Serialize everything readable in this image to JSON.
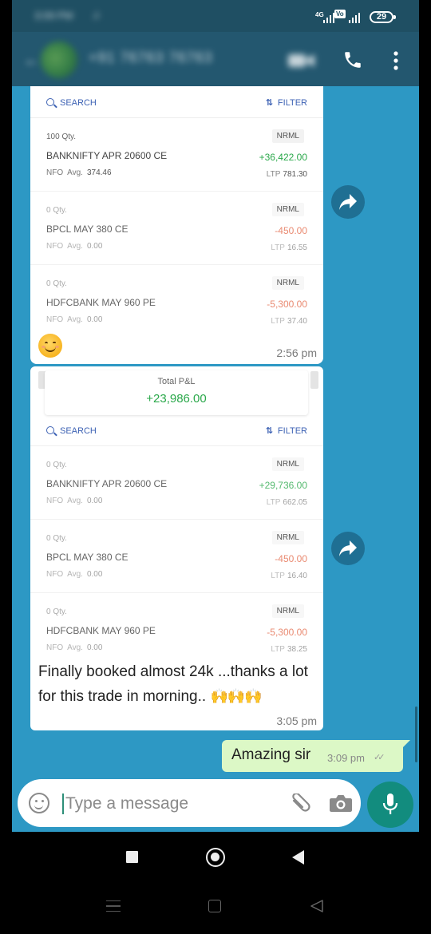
{
  "status_bar": {
    "time": "3:09 PM",
    "battery": "29"
  },
  "header": {
    "contact": "+91 76763 76763"
  },
  "positions_card_1": {
    "search_label": "SEARCH",
    "filter_label": "FILTER",
    "positions": [
      {
        "qty": "100 Qty.",
        "symbol": "BANKNIFTY APR 20600 CE",
        "exchange": "NFO",
        "avg_label": "Avg.",
        "avg": "374.46",
        "product": "NRML",
        "pnl": "+36,422.00",
        "ltp_label": "LTP",
        "ltp": "781.30"
      },
      {
        "qty": "0 Qty.",
        "symbol": "BPCL MAY 380 CE",
        "exchange": "NFO",
        "avg_label": "Avg.",
        "avg": "0.00",
        "product": "NRML",
        "pnl": "-450.00",
        "ltp_label": "LTP",
        "ltp": "16.55"
      },
      {
        "qty": "0 Qty.",
        "symbol": "HDFCBANK MAY 960 PE",
        "exchange": "NFO",
        "avg_label": "Avg.",
        "avg": "0.00",
        "product": "NRML",
        "pnl": "-5,300.00",
        "ltp_label": "LTP",
        "ltp": "37.40"
      }
    ],
    "time": "2:56 pm"
  },
  "positions_card_2": {
    "total_label": "Total P&L",
    "total_value": "+23,986.00",
    "search_label": "SEARCH",
    "filter_label": "FILTER",
    "positions": [
      {
        "qty": "0 Qty.",
        "symbol": "BANKNIFTY APR 20600 CE",
        "exchange": "NFO",
        "avg_label": "Avg.",
        "avg": "0.00",
        "product": "NRML",
        "pnl": "+29,736.00",
        "ltp_label": "LTP",
        "ltp": "662.05"
      },
      {
        "qty": "0 Qty.",
        "symbol": "BPCL MAY 380 CE",
        "exchange": "NFO",
        "avg_label": "Avg.",
        "avg": "0.00",
        "product": "NRML",
        "pnl": "-450.00",
        "ltp_label": "LTP",
        "ltp": "16.40"
      },
      {
        "qty": "0 Qty.",
        "symbol": "HDFCBANK MAY 960 PE",
        "exchange": "NFO",
        "avg_label": "Avg.",
        "avg": "0.00",
        "product": "NRML",
        "pnl": "-5,300.00",
        "ltp_label": "LTP",
        "ltp": "38.25"
      }
    ],
    "caption": "Finally booked almost 24k ...thanks a lot for this trade in morning..",
    "claps": "🙌🙌🙌",
    "time": "3:05 pm"
  },
  "sent_message": {
    "text": "Amazing sir",
    "time": "3:09 pm"
  },
  "input": {
    "placeholder": "Type a message"
  },
  "colors": {
    "chat_bg": "#2d98c4",
    "header": "#23576f",
    "profit": "#2aa84a",
    "loss": "#e46c4d",
    "sent_bubble": "#dcf8c6",
    "mic": "#128c7e"
  }
}
